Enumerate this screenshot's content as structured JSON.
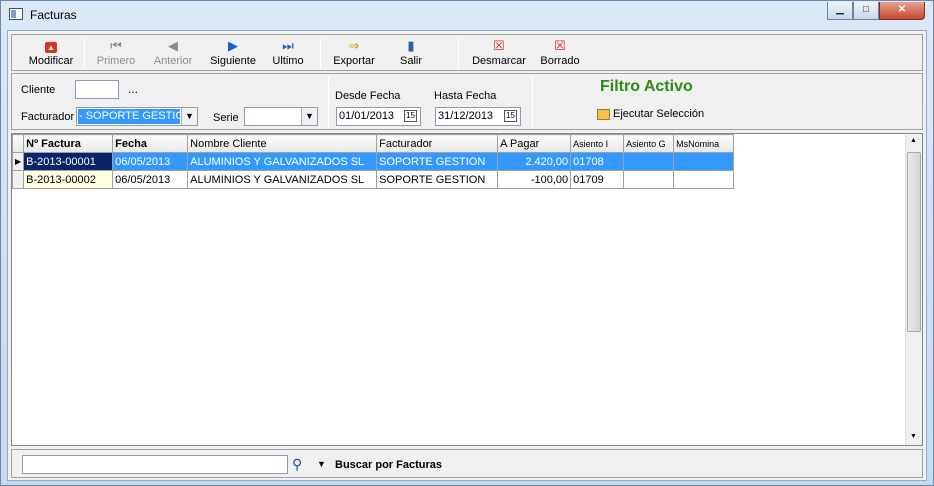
{
  "window": {
    "title": "Facturas"
  },
  "toolbar": {
    "modificar": "Modificar",
    "primero": "Primero",
    "anterior": "Anterior",
    "siguiente": "Siguiente",
    "ultimo": "Ultimo",
    "exportar": "Exportar",
    "salir": "Salir",
    "desmarcar": "Desmarcar",
    "borrado": "Borrado"
  },
  "filters": {
    "cliente_label": "Cliente",
    "cliente_value": "",
    "cliente_ellipsis": "...",
    "facturador_label": "Facturador",
    "facturador_value": "- SOPORTE GESTION",
    "serie_label": "Serie",
    "serie_value": "",
    "desde_label": "Desde Fecha",
    "desde_value": "01/01/2013",
    "hasta_label": "Hasta Fecha",
    "hasta_value": "31/12/2013",
    "calendar_glyph": "15",
    "filtro_activo": "Filtro Activo",
    "ejecutar": "Ejecutar Selección"
  },
  "grid": {
    "columns": [
      "Nº Factura",
      "Fecha",
      "Nombre Cliente",
      "Facturador",
      "A Pagar",
      "Asiento I",
      "Asiento G",
      "MsNomina"
    ],
    "rows": [
      [
        "B-2013-00001",
        "06/05/2013",
        "ALUMINIOS Y GALVANIZADOS SL",
        "SOPORTE GESTION",
        "2.420,00",
        "01708",
        "",
        ""
      ],
      [
        "B-2013-00002",
        "06/05/2013",
        "ALUMINIOS Y GALVANIZADOS SL",
        "SOPORTE GESTION",
        "-100,00",
        "01709",
        "",
        ""
      ]
    ]
  },
  "search": {
    "value": "",
    "label": "Buscar por Facturas"
  },
  "colors": {
    "selected_row": "#3399ff",
    "selected_first_cell": "#0a246a",
    "filtro_activo": "#2a8c10",
    "current_cell_bg": "#ffffe1"
  }
}
